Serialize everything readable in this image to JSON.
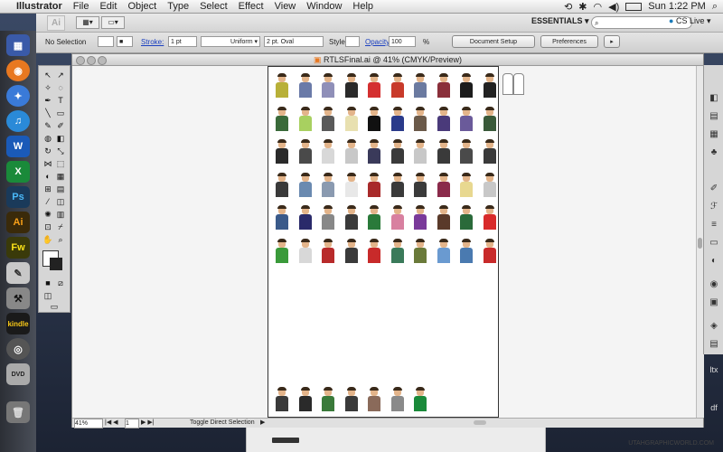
{
  "menubar": {
    "apple": "",
    "app": "Illustrator",
    "menus": [
      "File",
      "Edit",
      "Object",
      "Type",
      "Select",
      "Effect",
      "View",
      "Window",
      "Help"
    ],
    "clock": "Sun 1:22 PM"
  },
  "appbar": {
    "logo": "Ai",
    "workspace": "ESSENTIALS",
    "search_placeholder": "",
    "cs_live": "CS Live"
  },
  "control": {
    "selection": "No Selection",
    "stroke_label": "Stroke:",
    "stroke_value": "1 pt",
    "uniform": "Uniform",
    "brush": "2 pt. Oval",
    "style_label": "Style:",
    "opacity_label": "Opacity:",
    "opacity_value": "100",
    "opacity_unit": "%",
    "doc_setup": "Document Setup",
    "preferences": "Preferences"
  },
  "document": {
    "title": "RTLSFinal.ai @ 41% (CMYK/Preview)",
    "zoom": "41%",
    "artboard_nav": "1",
    "status": "Toggle Direct Selection"
  },
  "dock": {
    "kindle": "kindle",
    "dvd": "DVD"
  },
  "desktop": {
    "footer": "UTAHGRAPHICWORLD.COM",
    "right_labels": [
      "ltx",
      "df"
    ]
  },
  "colors": {
    "skin": "#e3b48a",
    "artboard_border": "#333333"
  },
  "figure_rows": [
    [
      "#b8b038",
      "#6a7aa8",
      "#8f8fb8",
      "#2a2a2a",
      "#d43030",
      "#c83a2a",
      "#6b7aa0",
      "#8a2f3a",
      "#1c1c1c",
      "#222222"
    ],
    [
      "#3a6a3a",
      "#a8d060",
      "#5a5a5a",
      "#e8e0b0",
      "#111111",
      "#2a3a8a",
      "#6b5a4a",
      "#4a3a7a",
      "#6a5a9a",
      "#3a5a3a"
    ],
    [
      "#2a2a2a",
      "#4a4a4a",
      "#d8d8d8",
      "#c8c8c8",
      "#3a3a5a",
      "#3a3a3a",
      "#c8c8c8",
      "#3a3a3a",
      "#4a4a4a",
      "#3a3a3a"
    ],
    [
      "#3a3a3a",
      "#6a8ab0",
      "#8a9ab0",
      "#e8e8e8",
      "#a82a2a",
      "#3a3a3a",
      "#3a3a3a",
      "#8a2a4a",
      "#e8d890",
      "#c8c8c8"
    ],
    [
      "#3a5a8a",
      "#2a2a6a",
      "#888888",
      "#3a3a3a",
      "#2a7a3a",
      "#d880a0",
      "#7a3a9a",
      "#5a3a2a",
      "#2a6a3a",
      "#d82a2a"
    ],
    [
      "#3a9a3a",
      "#d8d8d8",
      "#b82a2a",
      "#3a3a3a",
      "#c82a2a",
      "#3a7a5a",
      "#6a7a3a",
      "#6a9ad0",
      "#4a7ab0",
      "#c82a2a"
    ]
  ],
  "bottom_figures": [
    "#3a3a3a",
    "#2a2a2a",
    "#3a7a3a",
    "#3a3a3a",
    "#8a6a5a",
    "#8a8a8a",
    "#1a8a3a"
  ]
}
